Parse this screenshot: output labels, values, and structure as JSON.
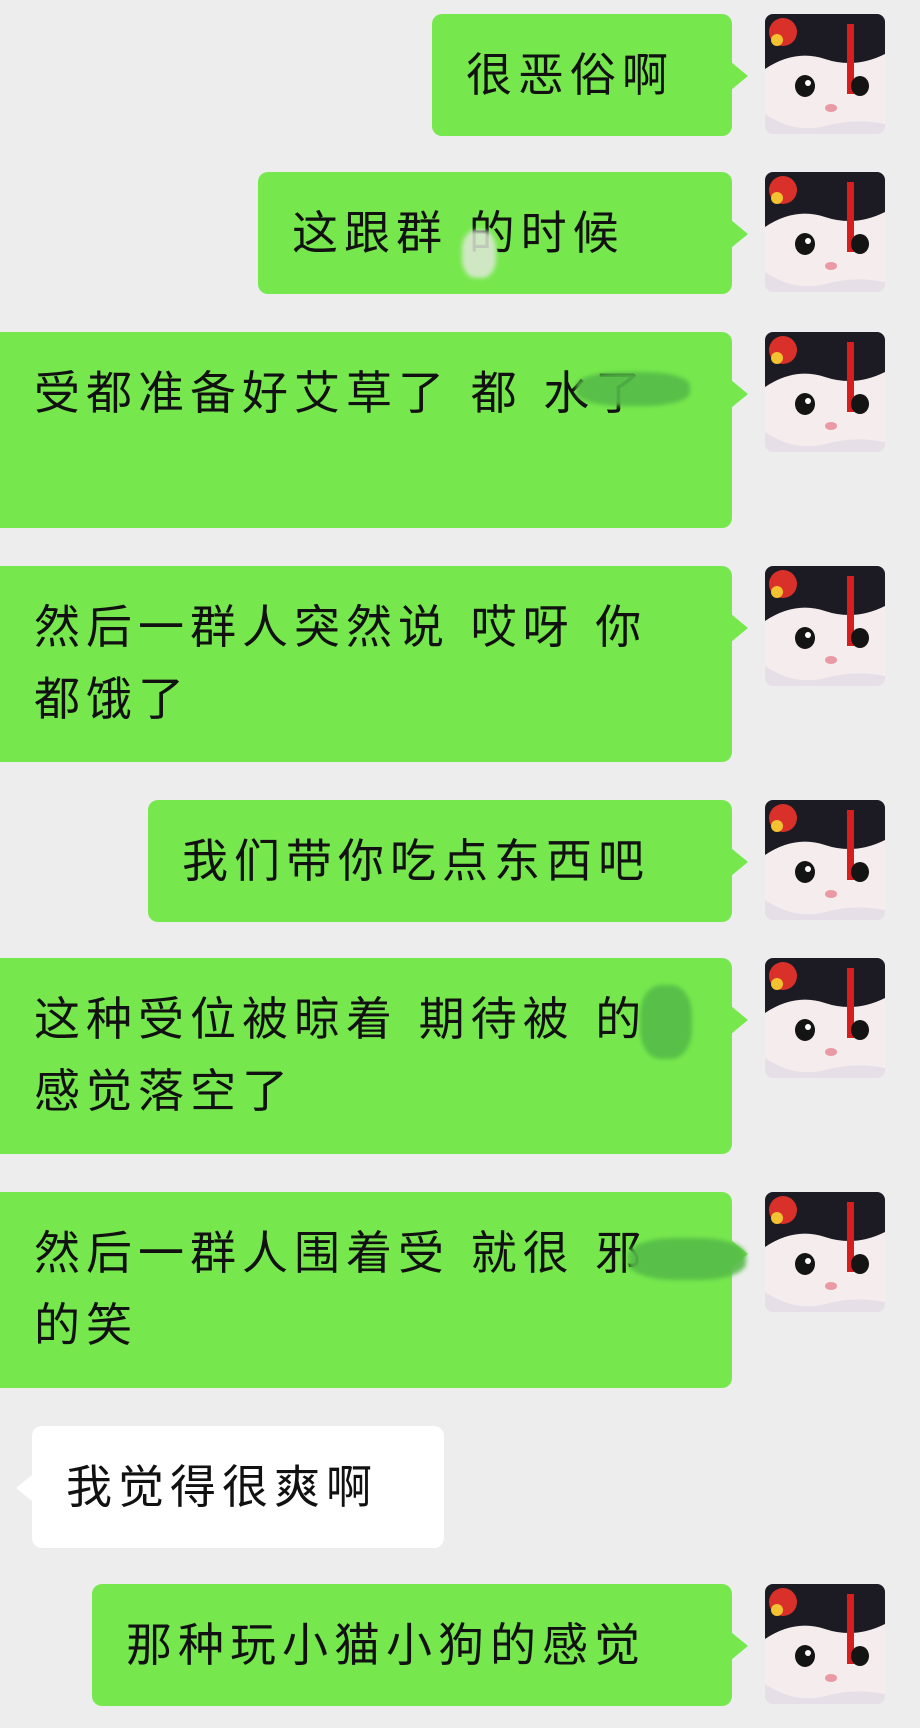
{
  "messages": [
    {
      "side": "right",
      "text": "很恶俗啊"
    },
    {
      "side": "right",
      "text": "这跟群 的时候"
    },
    {
      "side": "right",
      "text": "受都准备好艾草了 都 水了"
    },
    {
      "side": "right",
      "text": "然后一群人突然说 哎呀 你都饿了"
    },
    {
      "side": "right",
      "text": "我们带你吃点东西吧"
    },
    {
      "side": "right",
      "text": "这种受位被晾着 期待被 的感觉落空了"
    },
    {
      "side": "right",
      "text": "然后一群人围着受 就很 邪的笑"
    },
    {
      "side": "left",
      "text": "我觉得很爽啊"
    },
    {
      "side": "right",
      "text": "那种玩小猫小狗的感觉"
    }
  ],
  "colors": {
    "background": "#ededed",
    "bubble_me": "#76e84d",
    "bubble_other": "#ffffff"
  },
  "avatar": {
    "icon": "cat-avatar-icon"
  }
}
